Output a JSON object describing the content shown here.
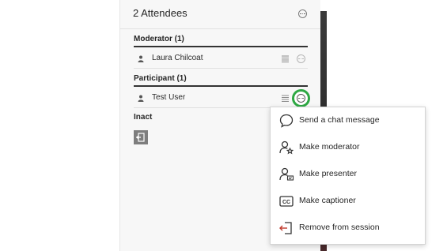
{
  "panel": {
    "title": "2 Attendees",
    "options_icon": "more-horizontal-circle-icon"
  },
  "sections": {
    "moderator": {
      "title": "Moderator (1)",
      "attendees": [
        {
          "name": "Laura Chilcoat",
          "icon": "person-icon"
        }
      ]
    },
    "participant": {
      "title": "Participant (1)",
      "attendees": [
        {
          "name": "Test User",
          "icon": "person-icon"
        }
      ]
    },
    "inactive": {
      "title": "Inact"
    }
  },
  "menu": {
    "items": [
      {
        "label": "Send a chat message",
        "icon": "chat-bubble-icon"
      },
      {
        "label": "Make moderator",
        "icon": "user-star-icon"
      },
      {
        "label": "Make presenter",
        "icon": "user-presenter-icon"
      },
      {
        "label": "Make captioner",
        "icon": "cc-icon"
      },
      {
        "label": "Remove from session",
        "icon": "exit-door-icon"
      }
    ]
  },
  "colors": {
    "highlight": "#2ea843",
    "remove_icon": "#c0392b",
    "panel_bg": "#f7f7f7",
    "text": "#262626"
  }
}
